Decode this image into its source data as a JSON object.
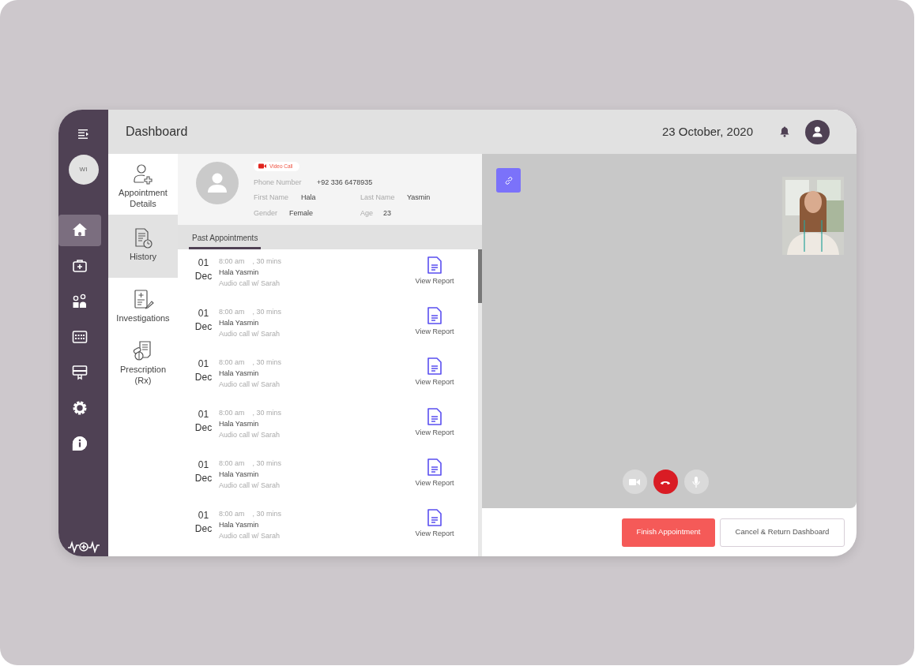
{
  "header": {
    "title": "Dashboard",
    "date": "23 October, 2020"
  },
  "sidebar": {
    "avatar": "WI",
    "nav": [
      {
        "selected": true
      },
      {
        "selected": false
      },
      {
        "selected": false
      },
      {
        "selected": false
      },
      {
        "selected": false
      },
      {
        "selected": false
      },
      {
        "selected": false
      }
    ]
  },
  "subnav": [
    {
      "label": "Appointment Details",
      "selected": false
    },
    {
      "label": "History",
      "selected": true
    },
    {
      "label": "Investigations",
      "selected": false
    },
    {
      "label": "Prescription (Rx)",
      "selected": false
    }
  ],
  "patient": {
    "call_type": "Video Call",
    "fields": [
      {
        "label": "Phone Number",
        "value": "+92 336 6478935"
      },
      {
        "label": "First Name",
        "value": "Hala"
      },
      {
        "label": "Last Name",
        "value": "Yasmin"
      },
      {
        "label": "Gender",
        "value": "Female"
      },
      {
        "label": "Age",
        "value": "23"
      }
    ]
  },
  "tabs": [
    {
      "label": "Past Appointments",
      "selected": true
    }
  ],
  "appointments": [
    {
      "day": "01",
      "month": "Dec",
      "time": "8:00 am",
      "duration": ", 30 mins",
      "name": "Hala Yasmin",
      "description": "Audio call w/ Sarah",
      "action": "View Report"
    },
    {
      "day": "01",
      "month": "Dec",
      "time": "8:00 am",
      "duration": ", 30 mins",
      "name": "Hala Yasmin",
      "description": "Audio call w/ Sarah",
      "action": "View Report"
    },
    {
      "day": "01",
      "month": "Dec",
      "time": "8:00 am",
      "duration": ", 30 mins",
      "name": "Hala Yasmin",
      "description": "Audio call w/ Sarah",
      "action": "View Report"
    },
    {
      "day": "01",
      "month": "Dec",
      "time": "8:00 am",
      "duration": ", 30 mins",
      "name": "Hala Yasmin",
      "description": "Audio call w/ Sarah",
      "action": "View Report"
    },
    {
      "day": "01",
      "month": "Dec",
      "time": "8:00 am",
      "duration": ", 30 mins",
      "name": "Hala Yasmin",
      "description": "Audio call w/ Sarah",
      "action": "View Report"
    },
    {
      "day": "01",
      "month": "Dec",
      "time": "8:00 am",
      "duration": ", 30 mins",
      "name": "Hala Yasmin",
      "description": "Audio call w/ Sarah",
      "action": "View Report"
    }
  ],
  "call": {
    "controls": [
      {
        "kind": "camera"
      },
      {
        "kind": "hangup"
      },
      {
        "kind": "mic"
      }
    ]
  },
  "buttons": [
    {
      "label": "Finish Appointment",
      "kind": "primary"
    },
    {
      "label": "Cancel & Return Dashboard",
      "kind": "secondary"
    }
  ]
}
